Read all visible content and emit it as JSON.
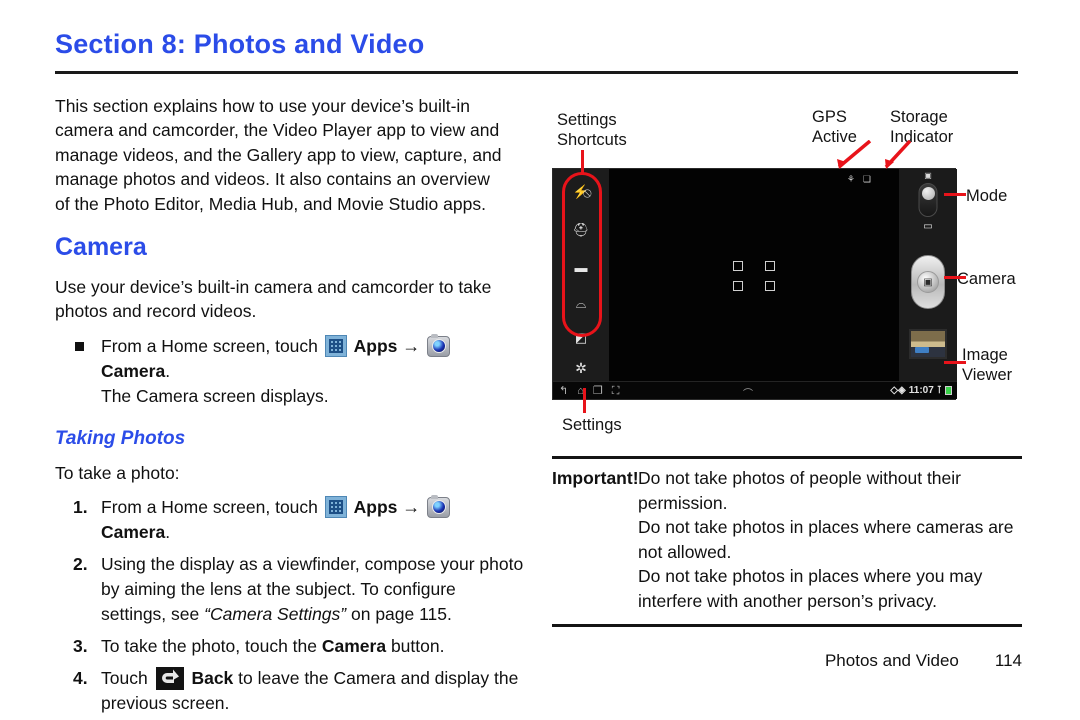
{
  "header": {
    "section_title": "Section 8: Photos and Video"
  },
  "intro": {
    "paragraph": "This section explains how to use your device’s built-in camera and camcorder, the Video Player app to view and manage videos, and the Gallery app to view, capture, and manage photos and videos. It also contains an overview of the Photo Editor, Media Hub, and Movie Studio apps."
  },
  "camera_section": {
    "heading": "Camera",
    "paragraph": "Use your device’s built-in camera and camcorder to take photos and record videos.",
    "bullet": {
      "pre": "From a Home screen, touch",
      "apps_label": "Apps",
      "arrow": "→",
      "camera_label": "Camera",
      "period": ".",
      "follow": "The Camera screen displays."
    }
  },
  "taking_photos": {
    "heading": "Taking Photos",
    "lead_in": "To take a photo:",
    "steps": [
      {
        "num": "1.",
        "pre": "From a Home screen, touch",
        "apps_label": "Apps",
        "arrow": "→",
        "camera_label": "Camera",
        "period": "."
      },
      {
        "num": "2.",
        "text_a": "Using the display as a viewfinder, compose your photo by aiming the lens at the subject. To configure settings, see ",
        "quote": "“Camera Settings”",
        "text_b": " on page 115."
      },
      {
        "num": "3.",
        "text_a": "To take the photo, touch the ",
        "bold": "Camera",
        "text_b": " button."
      },
      {
        "num": "4.",
        "text_a": "Touch",
        "bold": "Back",
        "text_b": " to leave the Camera and display the previous screen."
      }
    ]
  },
  "figure": {
    "labels": {
      "settings_shortcuts": "Settings\nShortcuts",
      "gps_active": "GPS\nActive",
      "storage_indicator": "Storage\nIndicator",
      "mode": "Mode",
      "camera": "Camera",
      "image_viewer": "Image\nViewer",
      "settings": "Settings"
    },
    "device_screen": {
      "left_rail_icons": [
        "flash-off-icon",
        "self-portrait-icon",
        "shooting-mode-icon",
        "scene-mode-icon",
        "exposure-value-icon"
      ],
      "settings_gear_icon": "gear-icon",
      "right_controls": {
        "mode_toggle": "camera-camcorder-toggle",
        "shutter": "shutter-button",
        "image_viewer_thumb": "image-thumbnail"
      },
      "status_bar": {
        "clock": "11:07",
        "gps_icon": "gps-active-icon",
        "storage_icon": "storage-indicator-icon",
        "signal_icon": "signal-icon",
        "battery_icon": "battery-icon"
      },
      "nav_bar": {
        "back_icon": "back-icon",
        "home_icon": "home-icon",
        "recents_icon": "recent-apps-icon",
        "screenshot_icon": "screenshot-icon"
      }
    }
  },
  "important_note": {
    "label": "Important!",
    "lines": [
      "Do not take photos of people without their permission.",
      "Do not take photos in places where cameras are not allowed.",
      "Do not take photos in places where you may interfere with another person’s privacy."
    ]
  },
  "footer": {
    "chapter": "Photos and Video",
    "page_number": "114"
  },
  "colors": {
    "heading_blue": "#2b4ce8",
    "annotation_red": "#e8131a",
    "text_black": "#111111"
  }
}
